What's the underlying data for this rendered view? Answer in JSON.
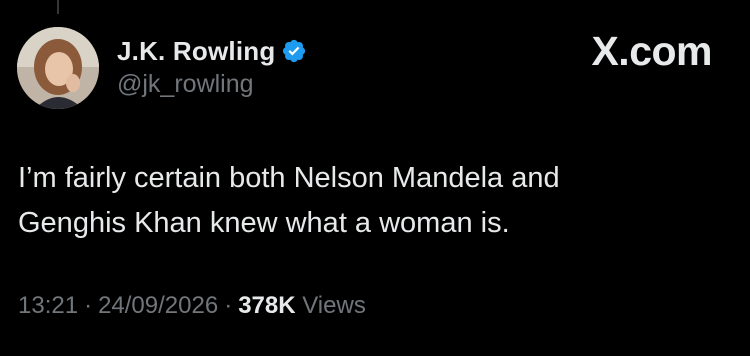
{
  "tweet": {
    "author": {
      "display_name": "J.K. Rowling",
      "handle": "@jk_rowling",
      "verified": true,
      "avatar_icon": "profile-photo"
    },
    "site_mark": "X.com",
    "text_line_1": "I’m fairly certain both Nelson Mandela and",
    "text_line_2": "Genghis Khan knew what a woman is.",
    "time": "13:21",
    "date": "24/09/2026",
    "separator": "·",
    "views_count": "378K",
    "views_label": "Views"
  },
  "colors": {
    "background": "#000000",
    "text_primary": "#e7e9ea",
    "text_secondary": "#71767b",
    "verified_badge": "#1d9bf0"
  }
}
